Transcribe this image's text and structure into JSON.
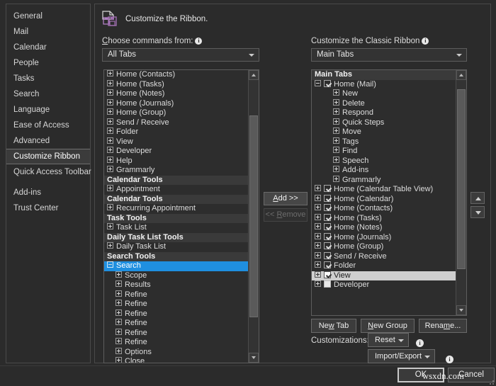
{
  "colors": {
    "dialog_bg": "#2b2b2b",
    "list_bg": "#2d2d2d",
    "selection_blue": "#1f8fe0",
    "selection_gray": "#cfcfcf",
    "group_header_bg": "#3a3a3a",
    "border": "#5d5d5d",
    "icon_accent": "#a06fb0"
  },
  "sidebar": {
    "items": [
      {
        "label": "General",
        "selected": false,
        "gap_above": false
      },
      {
        "label": "Mail",
        "selected": false,
        "gap_above": false
      },
      {
        "label": "Calendar",
        "selected": false,
        "gap_above": false
      },
      {
        "label": "People",
        "selected": false,
        "gap_above": false
      },
      {
        "label": "Tasks",
        "selected": false,
        "gap_above": false
      },
      {
        "label": "Search",
        "selected": false,
        "gap_above": false
      },
      {
        "label": "Language",
        "selected": false,
        "gap_above": false
      },
      {
        "label": "Ease of Access",
        "selected": false,
        "gap_above": false
      },
      {
        "label": "Advanced",
        "selected": false,
        "gap_above": false
      },
      {
        "label": "Customize Ribbon",
        "selected": true,
        "gap_above": false
      },
      {
        "label": "Quick Access Toolbar",
        "selected": false,
        "gap_above": false
      },
      {
        "label": "Add-ins",
        "selected": false,
        "gap_above": true
      },
      {
        "label": "Trust Center",
        "selected": false,
        "gap_above": false
      }
    ]
  },
  "header": {
    "title": "Customize the Ribbon.",
    "icon": "customize-ribbon-icon"
  },
  "left_panel": {
    "label_prefix": "C",
    "label_rest": "hoose commands from:",
    "info_icon": "info-icon",
    "combo_value": "All Tabs",
    "combo_arrow_icon": "chevron-down-icon",
    "rows": [
      {
        "label": "Home (Contacts)",
        "kind": "item",
        "expander": "plus",
        "indent": 0
      },
      {
        "label": "Home (Tasks)",
        "kind": "item",
        "expander": "plus",
        "indent": 0
      },
      {
        "label": "Home (Notes)",
        "kind": "item",
        "expander": "plus",
        "indent": 0
      },
      {
        "label": "Home (Journals)",
        "kind": "item",
        "expander": "plus",
        "indent": 0
      },
      {
        "label": "Home (Group)",
        "kind": "item",
        "expander": "plus",
        "indent": 0
      },
      {
        "label": "Send / Receive",
        "kind": "item",
        "expander": "plus",
        "indent": 0
      },
      {
        "label": "Folder",
        "kind": "item",
        "expander": "plus",
        "indent": 0
      },
      {
        "label": "View",
        "kind": "item",
        "expander": "plus",
        "indent": 0
      },
      {
        "label": "Developer",
        "kind": "item",
        "expander": "plus",
        "indent": 0
      },
      {
        "label": "Help",
        "kind": "item",
        "expander": "plus",
        "indent": 0
      },
      {
        "label": "Grammarly",
        "kind": "item",
        "expander": "plus",
        "indent": 0
      },
      {
        "label": "Calendar Tools",
        "kind": "group",
        "expander": "none",
        "indent": 0
      },
      {
        "label": "Appointment",
        "kind": "item",
        "expander": "plus",
        "indent": 0
      },
      {
        "label": "Calendar Tools",
        "kind": "group",
        "expander": "none",
        "indent": 0
      },
      {
        "label": "Recurring Appointment",
        "kind": "item",
        "expander": "plus",
        "indent": 0
      },
      {
        "label": "Task Tools",
        "kind": "group",
        "expander": "none",
        "indent": 0
      },
      {
        "label": "Task List",
        "kind": "item",
        "expander": "plus",
        "indent": 0
      },
      {
        "label": "Daily Task List Tools",
        "kind": "group",
        "expander": "none",
        "indent": 0
      },
      {
        "label": "Daily Task List",
        "kind": "item",
        "expander": "plus",
        "indent": 0
      },
      {
        "label": "Search Tools",
        "kind": "group",
        "expander": "none",
        "indent": 0
      },
      {
        "label": "Search",
        "kind": "selected-blue",
        "expander": "minus",
        "indent": 0
      },
      {
        "label": "Scope",
        "kind": "item",
        "expander": "plus",
        "indent": 1
      },
      {
        "label": "Results",
        "kind": "item",
        "expander": "plus",
        "indent": 1
      },
      {
        "label": "Refine",
        "kind": "item",
        "expander": "plus",
        "indent": 1
      },
      {
        "label": "Refine",
        "kind": "item",
        "expander": "plus",
        "indent": 1
      },
      {
        "label": "Refine",
        "kind": "item",
        "expander": "plus",
        "indent": 1
      },
      {
        "label": "Refine",
        "kind": "item",
        "expander": "plus",
        "indent": 1
      },
      {
        "label": "Refine",
        "kind": "item",
        "expander": "plus",
        "indent": 1
      },
      {
        "label": "Refine",
        "kind": "item",
        "expander": "plus",
        "indent": 1
      },
      {
        "label": "Options",
        "kind": "item",
        "expander": "plus",
        "indent": 1
      },
      {
        "label": "Close",
        "kind": "item",
        "expander": "plus",
        "indent": 1
      }
    ],
    "scrollbar": {
      "up_icon": "scroll-up-icon",
      "down_icon": "scroll-down-icon",
      "thumb_top_pct": 13,
      "thumb_height_pct": 74
    }
  },
  "right_panel": {
    "label": "Customize the Classic Ribbon",
    "info_icon": "info-icon",
    "combo_value": "Main Tabs",
    "combo_arrow_icon": "chevron-down-icon",
    "rows": [
      {
        "label": "Main Tabs",
        "kind": "group",
        "expander": "none",
        "checkbox": "none",
        "indent": 0
      },
      {
        "label": "Home (Mail)",
        "kind": "item",
        "expander": "minus",
        "checkbox": "on",
        "indent": 0
      },
      {
        "label": "New",
        "kind": "item",
        "expander": "plus",
        "checkbox": "none",
        "indent": 2
      },
      {
        "label": "Delete",
        "kind": "item",
        "expander": "plus",
        "checkbox": "none",
        "indent": 2
      },
      {
        "label": "Respond",
        "kind": "item",
        "expander": "plus",
        "checkbox": "none",
        "indent": 2
      },
      {
        "label": "Quick Steps",
        "kind": "item",
        "expander": "plus",
        "checkbox": "none",
        "indent": 2
      },
      {
        "label": "Move",
        "kind": "item",
        "expander": "plus",
        "checkbox": "none",
        "indent": 2
      },
      {
        "label": "Tags",
        "kind": "item",
        "expander": "plus",
        "checkbox": "none",
        "indent": 2
      },
      {
        "label": "Find",
        "kind": "item",
        "expander": "plus",
        "checkbox": "none",
        "indent": 2
      },
      {
        "label": "Speech",
        "kind": "item",
        "expander": "plus",
        "checkbox": "none",
        "indent": 2
      },
      {
        "label": "Add-ins",
        "kind": "item",
        "expander": "plus",
        "checkbox": "none",
        "indent": 2
      },
      {
        "label": "Grammarly",
        "kind": "item",
        "expander": "plus",
        "checkbox": "none",
        "indent": 2
      },
      {
        "label": "Home (Calendar Table View)",
        "kind": "item",
        "expander": "plus",
        "checkbox": "on",
        "indent": 0
      },
      {
        "label": "Home (Calendar)",
        "kind": "item",
        "expander": "plus",
        "checkbox": "on",
        "indent": 0
      },
      {
        "label": "Home (Contacts)",
        "kind": "item",
        "expander": "plus",
        "checkbox": "on",
        "indent": 0
      },
      {
        "label": "Home (Tasks)",
        "kind": "item",
        "expander": "plus",
        "checkbox": "on",
        "indent": 0
      },
      {
        "label": "Home (Notes)",
        "kind": "item",
        "expander": "plus",
        "checkbox": "on",
        "indent": 0
      },
      {
        "label": "Home (Journals)",
        "kind": "item",
        "expander": "plus",
        "checkbox": "on",
        "indent": 0
      },
      {
        "label": "Home (Group)",
        "kind": "item",
        "expander": "plus",
        "checkbox": "on",
        "indent": 0
      },
      {
        "label": "Send / Receive",
        "kind": "item",
        "expander": "plus",
        "checkbox": "on",
        "indent": 0
      },
      {
        "label": "Folder",
        "kind": "item",
        "expander": "plus",
        "checkbox": "on",
        "indent": 0
      },
      {
        "label": "View",
        "kind": "selected-gray",
        "expander": "plus",
        "checkbox": "on",
        "indent": 0
      },
      {
        "label": "Developer",
        "kind": "item",
        "expander": "plus",
        "checkbox": "blank",
        "indent": 0
      }
    ],
    "scrollbar": {
      "up_icon": "scroll-up-icon",
      "down_icon": "scroll-down-icon",
      "thumb_top_pct": 4,
      "thumb_height_pct": 80
    }
  },
  "transfer_buttons": {
    "add_prefix": "A",
    "add_rest": "dd >>",
    "remove_prefix": "<< ",
    "remove_acc": "R",
    "remove_rest": "emove",
    "add_enabled": true,
    "remove_enabled": false
  },
  "move_buttons": {
    "up_icon": "move-up-icon",
    "down_icon": "move-down-icon"
  },
  "tab_buttons": {
    "new_tab_pre": "Ne",
    "new_tab_acc": "w",
    "new_tab_post": " Tab",
    "new_group_acc": "N",
    "new_group_post": "ew Group",
    "rename_pre": "Rena",
    "rename_acc": "m",
    "rename_post": "e..."
  },
  "customizations": {
    "label": "Customizations:",
    "reset_pre": "R",
    "reset_acc": "e",
    "reset_post": "set",
    "import_export_label": "Import/Export",
    "reset_info_icon": "info-icon",
    "import_info_icon": "info-icon"
  },
  "footer": {
    "ok_label": "OK",
    "cancel_label": "Cancel",
    "watermark": "wsxdn.com",
    "grip": "resize-grip-icon"
  }
}
